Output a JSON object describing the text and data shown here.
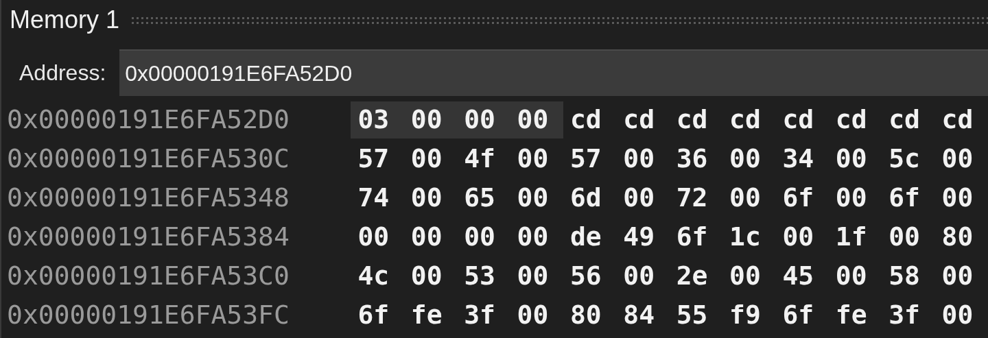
{
  "window": {
    "title": "Memory 1"
  },
  "address_bar": {
    "label": "Address:",
    "value": "0x00000191E6FA52D0"
  },
  "rows": [
    {
      "address": "0x00000191E6FA52D0",
      "bytes": [
        {
          "value": "03",
          "selected": true
        },
        {
          "value": "00",
          "selected": true
        },
        {
          "value": "00",
          "selected": true
        },
        {
          "value": "00",
          "selected": true
        },
        {
          "value": "cd",
          "selected": false
        },
        {
          "value": "cd",
          "selected": false
        },
        {
          "value": "cd",
          "selected": false
        },
        {
          "value": "cd",
          "selected": false
        },
        {
          "value": "cd",
          "selected": false
        },
        {
          "value": "cd",
          "selected": false
        },
        {
          "value": "cd",
          "selected": false
        },
        {
          "value": "cd",
          "selected": false
        }
      ]
    },
    {
      "address": "0x00000191E6FA530C",
      "bytes": [
        {
          "value": "57",
          "selected": false
        },
        {
          "value": "00",
          "selected": false
        },
        {
          "value": "4f",
          "selected": false
        },
        {
          "value": "00",
          "selected": false
        },
        {
          "value": "57",
          "selected": false
        },
        {
          "value": "00",
          "selected": false
        },
        {
          "value": "36",
          "selected": false
        },
        {
          "value": "00",
          "selected": false
        },
        {
          "value": "34",
          "selected": false
        },
        {
          "value": "00",
          "selected": false
        },
        {
          "value": "5c",
          "selected": false
        },
        {
          "value": "00",
          "selected": false
        }
      ]
    },
    {
      "address": "0x00000191E6FA5348",
      "bytes": [
        {
          "value": "74",
          "selected": false
        },
        {
          "value": "00",
          "selected": false
        },
        {
          "value": "65",
          "selected": false
        },
        {
          "value": "00",
          "selected": false
        },
        {
          "value": "6d",
          "selected": false
        },
        {
          "value": "00",
          "selected": false
        },
        {
          "value": "72",
          "selected": false
        },
        {
          "value": "00",
          "selected": false
        },
        {
          "value": "6f",
          "selected": false
        },
        {
          "value": "00",
          "selected": false
        },
        {
          "value": "6f",
          "selected": false
        },
        {
          "value": "00",
          "selected": false
        }
      ]
    },
    {
      "address": "0x00000191E6FA5384",
      "bytes": [
        {
          "value": "00",
          "selected": false
        },
        {
          "value": "00",
          "selected": false
        },
        {
          "value": "00",
          "selected": false
        },
        {
          "value": "00",
          "selected": false
        },
        {
          "value": "de",
          "selected": false
        },
        {
          "value": "49",
          "selected": false
        },
        {
          "value": "6f",
          "selected": false
        },
        {
          "value": "1c",
          "selected": false
        },
        {
          "value": "00",
          "selected": false
        },
        {
          "value": "1f",
          "selected": false
        },
        {
          "value": "00",
          "selected": false
        },
        {
          "value": "80",
          "selected": false
        }
      ]
    },
    {
      "address": "0x00000191E6FA53C0",
      "bytes": [
        {
          "value": "4c",
          "selected": false
        },
        {
          "value": "00",
          "selected": false
        },
        {
          "value": "53",
          "selected": false
        },
        {
          "value": "00",
          "selected": false
        },
        {
          "value": "56",
          "selected": false
        },
        {
          "value": "00",
          "selected": false
        },
        {
          "value": "2e",
          "selected": false
        },
        {
          "value": "00",
          "selected": false
        },
        {
          "value": "45",
          "selected": false
        },
        {
          "value": "00",
          "selected": false
        },
        {
          "value": "58",
          "selected": false
        },
        {
          "value": "00",
          "selected": false
        }
      ]
    },
    {
      "address": "0x00000191E6FA53FC",
      "bytes": [
        {
          "value": "6f",
          "selected": false
        },
        {
          "value": "fe",
          "selected": false
        },
        {
          "value": "3f",
          "selected": false
        },
        {
          "value": "00",
          "selected": false
        },
        {
          "value": "80",
          "selected": false
        },
        {
          "value": "84",
          "selected": false
        },
        {
          "value": "55",
          "selected": false
        },
        {
          "value": "f9",
          "selected": false
        },
        {
          "value": "6f",
          "selected": false
        },
        {
          "value": "fe",
          "selected": false
        },
        {
          "value": "3f",
          "selected": false
        },
        {
          "value": "00",
          "selected": false
        }
      ]
    }
  ]
}
